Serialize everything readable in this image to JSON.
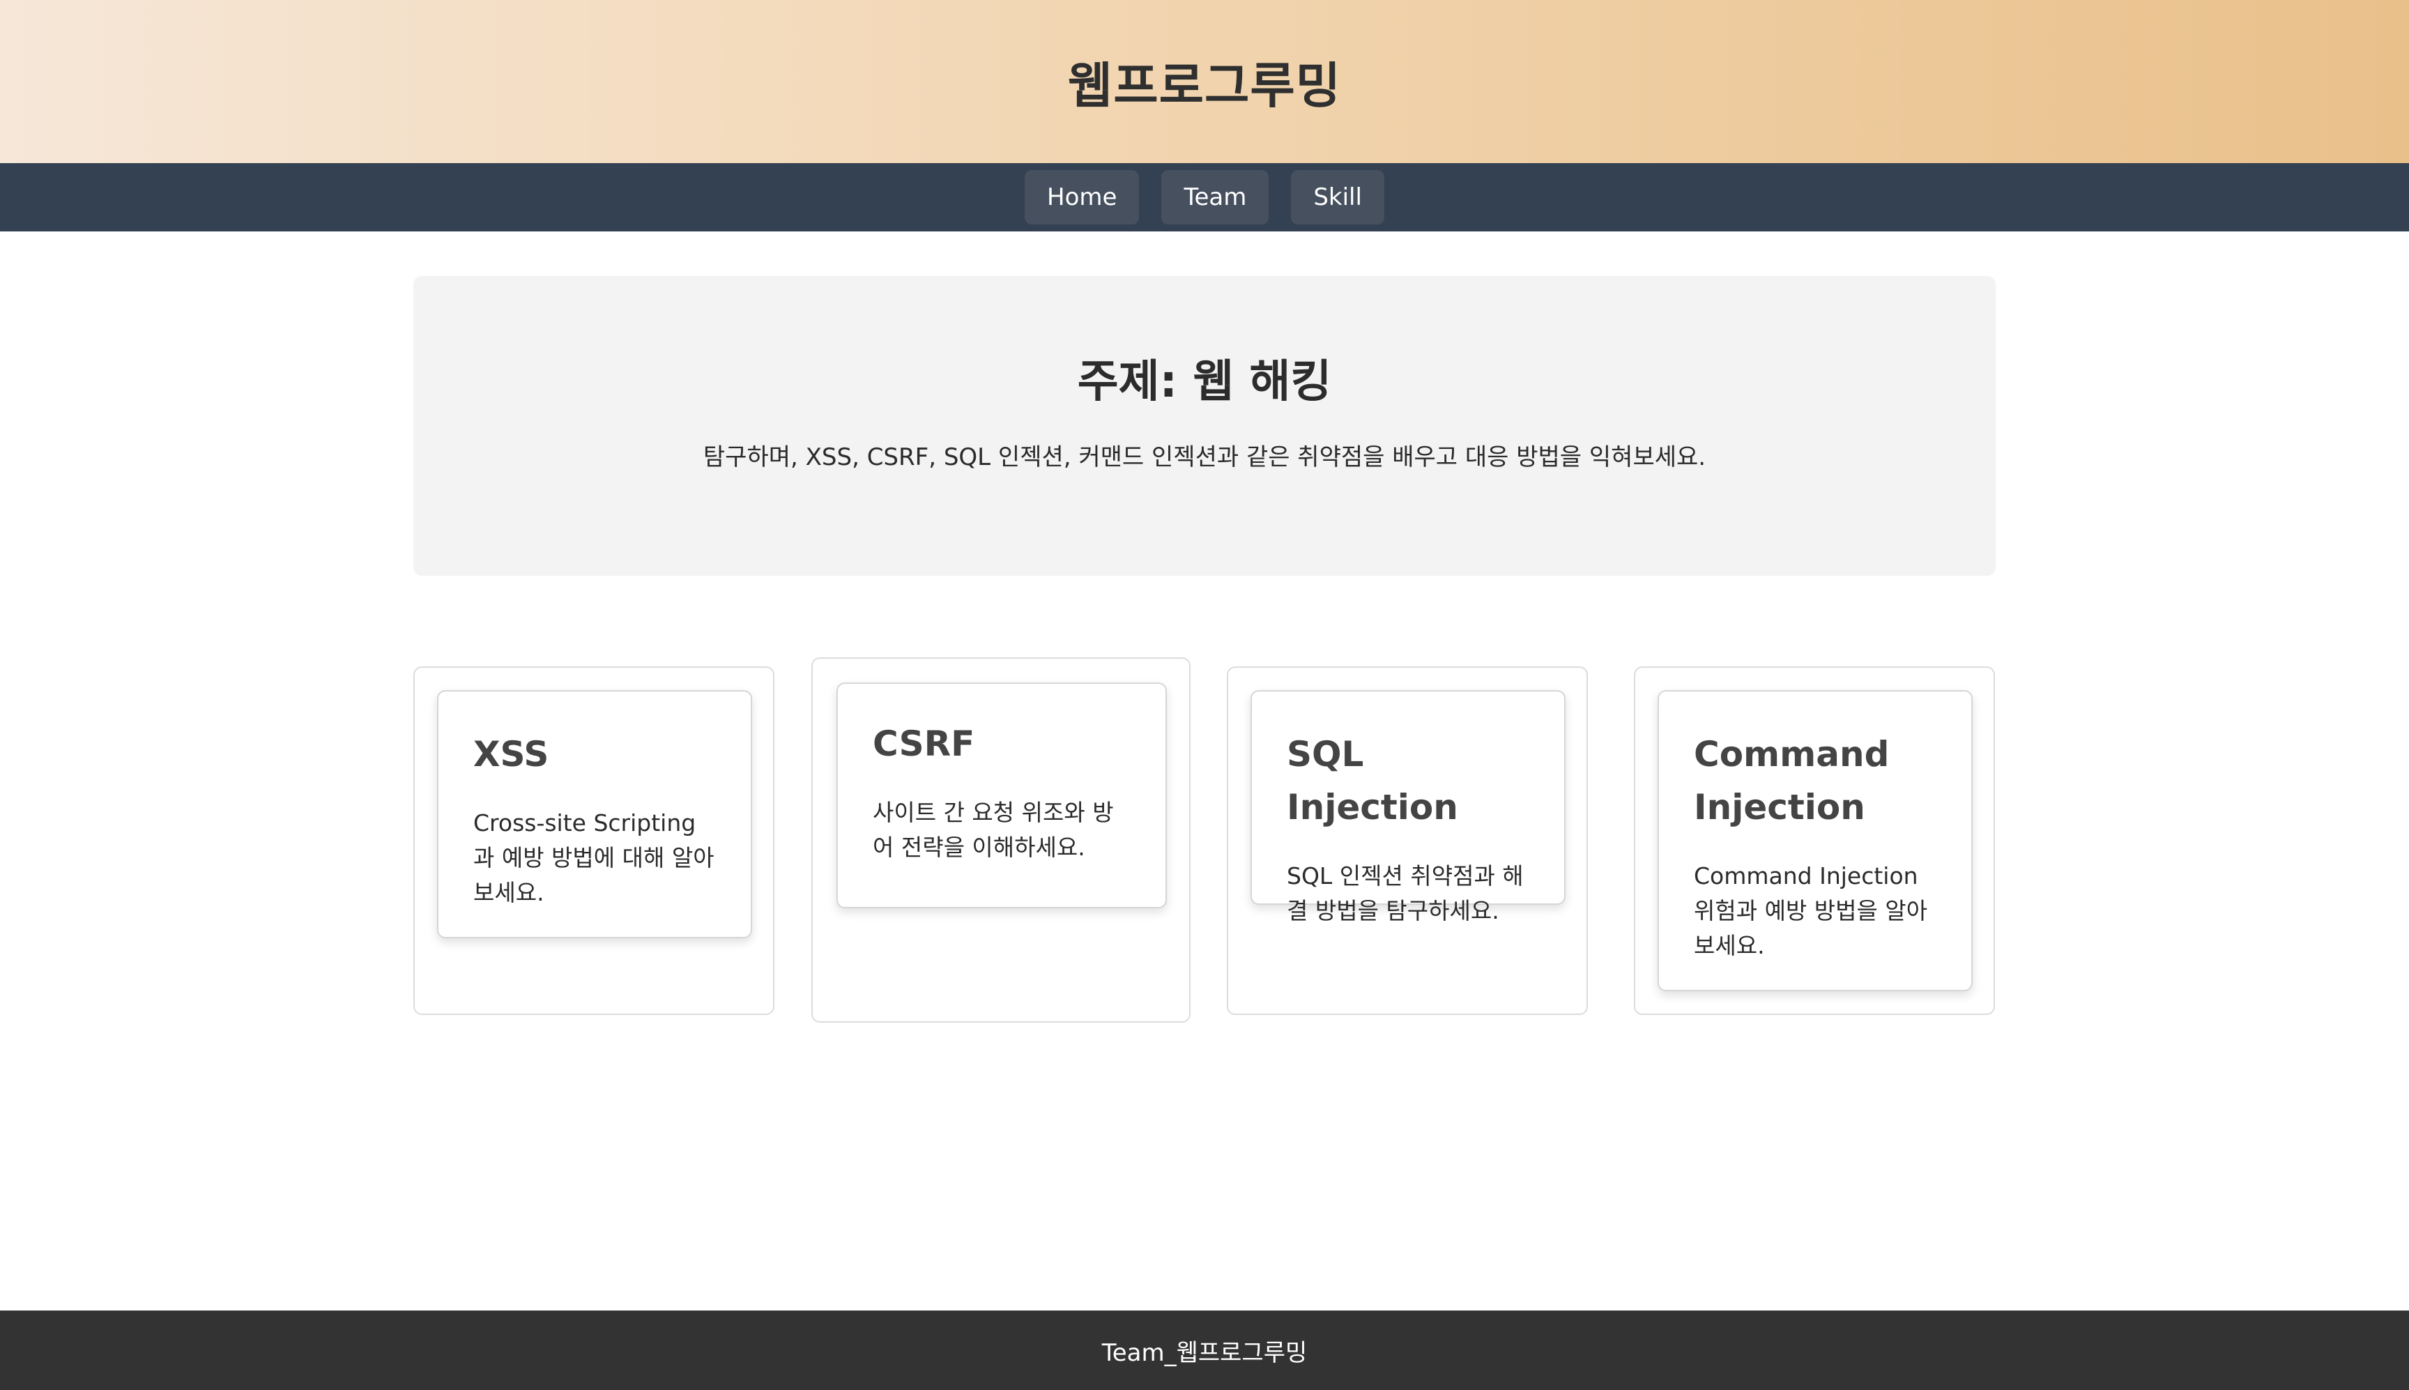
{
  "header": {
    "title": "웹프로그루밍"
  },
  "nav": {
    "items": [
      "Home",
      "Team",
      "Skill"
    ]
  },
  "hero": {
    "title": "주제: 웹 해킹",
    "text": "탐구하며, XSS, CSRF, SQL 인젝션, 커맨드 인젝션과 같은 취약점을 배우고 대응 방법을 익혀보세요."
  },
  "cards": [
    {
      "title": "XSS",
      "text": "Cross-site Scripting 과 예방 방법에 대해 알아보세요."
    },
    {
      "title": "CSRF",
      "text": "사이트 간 요청 위조와 방어 전략을 이해하세요."
    },
    {
      "title": "SQL Injection",
      "text": "SQL 인젝션 취약점과 해결 방법을 탐구하세요."
    },
    {
      "title": "Command Injection",
      "text": "Command Injection 위험과 예방 방법을 알아보세요."
    }
  ],
  "footer": {
    "text": "Team_웹프로그루밍"
  }
}
